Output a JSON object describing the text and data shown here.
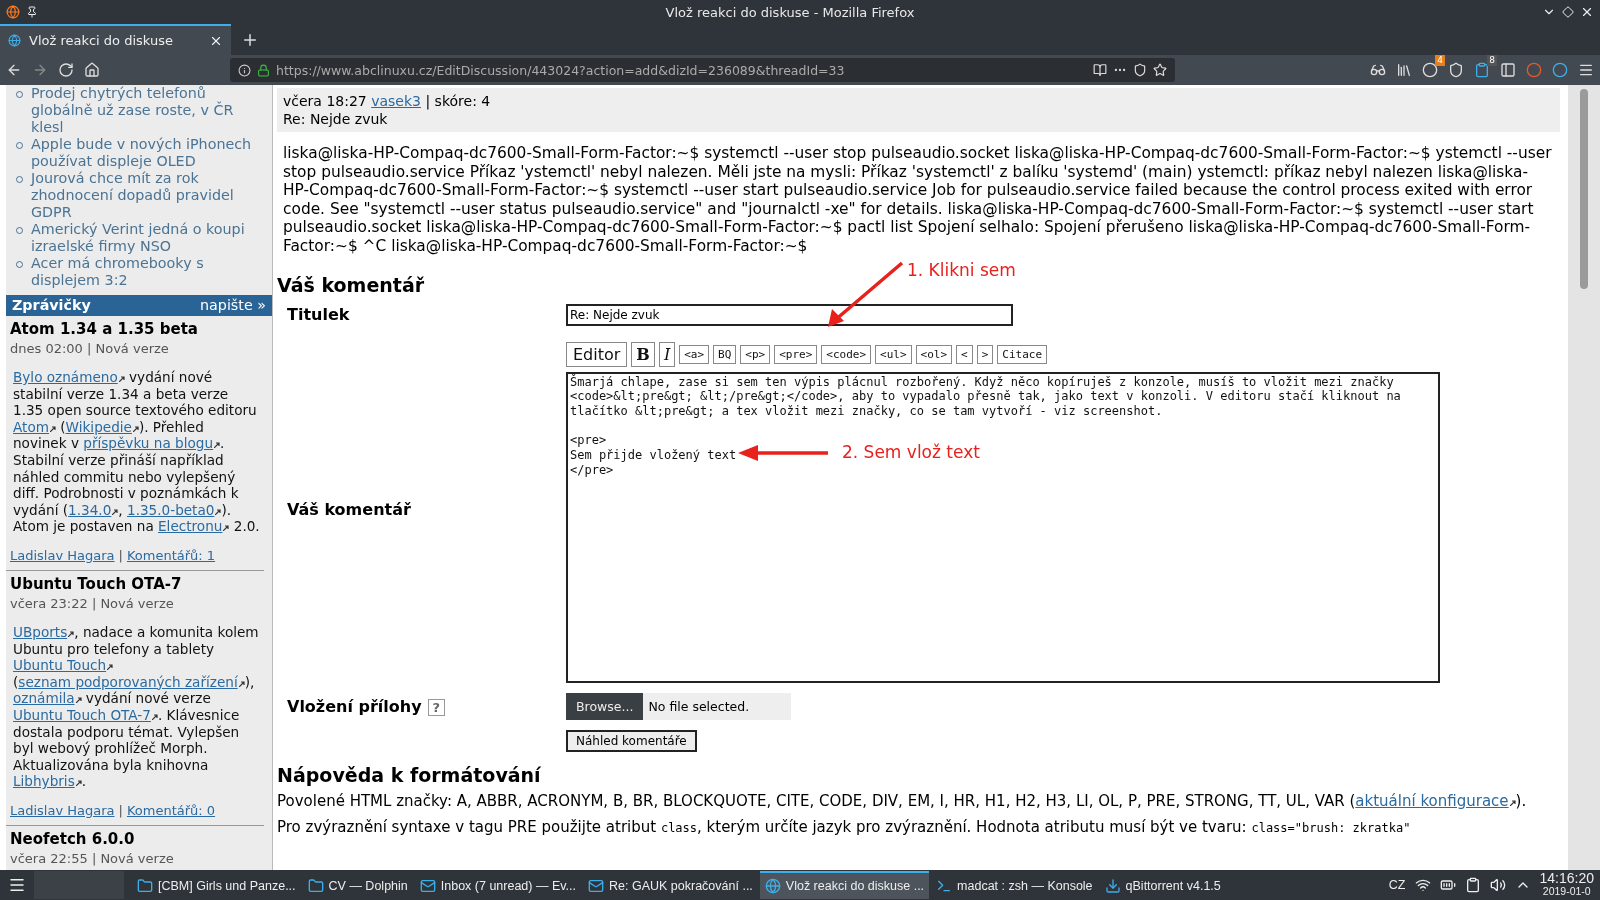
{
  "window": {
    "title": "Vlož reakci do diskuse - Mozilla Firefox"
  },
  "tabs": [
    {
      "label": "Vlož reakci do diskuse",
      "selected": true
    }
  ],
  "address_bar": {
    "url": "https://www.abclinuxu.cz/EditDiscussion/443024?action=add&dizId=236089&threadId=33"
  },
  "toolbar_badges": [
    "4",
    "8"
  ],
  "sidebar": {
    "news_links": [
      "Prodej chytrých telefonů globálně už zase roste, v ČR klesl",
      "Apple bude v nových iPhonech používat displeje OLED",
      "Jourová chce mít za rok zhodnocení dopadů pravidel GDPR",
      "Americký Verint jedná o koupi izraelské firmy NSO",
      "Acer má chromebooky s displejem 3:2"
    ],
    "section": {
      "title": "Zprávičky",
      "action": "napište »"
    },
    "news": [
      {
        "title": "Atom 1.34 a 1.35 beta",
        "meta": "dnes 02:00 | Nová verze",
        "body": [
          {
            "kind": "link",
            "text": "Bylo oznámeno"
          },
          {
            "kind": "text",
            "text": " vydání nové stabilní verze 1.34 a beta verze 1.35 open source textového editoru "
          },
          {
            "kind": "link",
            "text": "Atom"
          },
          {
            "kind": "text",
            "text": " ("
          },
          {
            "kind": "link",
            "text": "Wikipedie"
          },
          {
            "kind": "text",
            "text": "). Přehled novinek v "
          },
          {
            "kind": "link",
            "text": "příspěvku na blogu"
          },
          {
            "kind": "text",
            "text": ". Stabilní verze přináší například náhled commitu nebo vylepšený diff. Podrobnosti v poznámkách k vydání ("
          },
          {
            "kind": "link",
            "text": "1.34.0"
          },
          {
            "kind": "text",
            "text": ", "
          },
          {
            "kind": "link",
            "text": "1.35.0-beta0"
          },
          {
            "kind": "text",
            "text": "). Atom je postaven na "
          },
          {
            "kind": "link",
            "text": "Electronu"
          },
          {
            "kind": "text",
            "text": " 2.0."
          }
        ],
        "author": "Ladislav Hagara",
        "separator": "|",
        "comments": "Komentářů: 1"
      },
      {
        "title": "Ubuntu Touch OTA-7",
        "meta": "včera 23:22 | Nová verze",
        "body": [
          {
            "kind": "link",
            "text": "UBports"
          },
          {
            "kind": "text",
            "text": ", nadace a komunita kolem Ubuntu pro telefony a tablety "
          },
          {
            "kind": "link",
            "text": "Ubuntu Touch"
          },
          {
            "kind": "text",
            "text": " ("
          },
          {
            "kind": "link",
            "text": "seznam podporovaných zařízení"
          },
          {
            "kind": "text",
            "text": "), "
          },
          {
            "kind": "link",
            "text": "oznámila"
          },
          {
            "kind": "text",
            "text": " vydání nové verze "
          },
          {
            "kind": "link",
            "text": "Ubuntu Touch OTA-7"
          },
          {
            "kind": "text",
            "text": ". Klávesnice dostala podporu témat. Vylepšen byl webový prohlížeč Morph. Aktualizována byla knihovna "
          },
          {
            "kind": "link",
            "text": "Libhybris"
          },
          {
            "kind": "text",
            "text": "."
          }
        ],
        "author": "Ladislav Hagara",
        "separator": "|",
        "comments": "Komentářů: 0"
      },
      {
        "title": "Neofetch 6.0.0",
        "meta": "včera 22:55 | Nová verze"
      }
    ]
  },
  "comment": {
    "meta": [
      {
        "kind": "text",
        "text": "včera 18:27 "
      },
      {
        "kind": "link",
        "text": "vasek3"
      },
      {
        "kind": "text",
        "text": " | skóre: 4"
      }
    ],
    "subject": "Re: Nejde zvuk",
    "body": "liska@liska-HP-Compaq-dc7600-Small-Form-Factor:~$ systemctl --user stop pulseaudio.socket liska@liska-HP-Compaq-dc7600-Small-Form-Factor:~$ ystemctl --user stop pulseaudio.service Příkaz 'ystemctl' nebyl nalezen. Měli jste na mysli: Příkaz 'systemctl' z balíku 'systemd' (main) ystemctl: příkaz nebyl nalezen liska@liska-HP-Compaq-dc7600-Small-Form-Factor:~$ systemctl --user start pulseaudio.service Job for pulseaudio.service failed because the control process exited with error code. See \"systemctl --user status pulseaudio.service\" and \"journalctl -xe\" for details. liska@liska-HP-Compaq-dc7600-Small-Form-Factor:~$ systemctl --user start pulseaudio.socket liska@liska-HP-Compaq-dc7600-Small-Form-Factor:~$ pactl list Spojení selhalo: Spojení přerušeno liska@liska-HP-Compaq-dc7600-Small-Form-Factor:~$ ^C liska@liska-HP-Compaq-dc7600-Small-Form-Factor:~$"
  },
  "form": {
    "heading": "Váš komentář",
    "title_label": "Titulek",
    "title_value": "Re: Nejde zvuk",
    "editor_buttons": [
      {
        "label": "Editor",
        "kind": "mode"
      },
      {
        "label": "B",
        "kind": "bold"
      },
      {
        "label": "I",
        "kind": "italic"
      },
      {
        "label": "<a>",
        "kind": "tag"
      },
      {
        "label": "BQ",
        "kind": "tag"
      },
      {
        "label": "<p>",
        "kind": "tag"
      },
      {
        "label": "<pre>",
        "kind": "tag"
      },
      {
        "label": "<code>",
        "kind": "tag"
      },
      {
        "label": "<ul>",
        "kind": "tag"
      },
      {
        "label": "<ol>",
        "kind": "tag"
      },
      {
        "label": "<",
        "kind": "tag"
      },
      {
        "label": ">",
        "kind": "tag"
      },
      {
        "label": "Citace",
        "kind": "tag"
      }
    ],
    "comment_label": "Váš komentář",
    "comment_value": "Šmarjá chlape, zase si sem ten výpis plácnul rozbořený. Když něco kopíruješ z konzole, musíš to vložit mezi značky <code>&lt;pre&gt; &lt;/pre&gt;</code>, aby to vypadalo přesně tak, jako text v konzoli. V editoru stačí kliknout na tlačítko &lt;pre&gt; a tex vložit mezi značky, co se tam vytvoří - viz screenshot.\n\n<pre>\nSem přijde vložený text\n</pre>",
    "attachment_label": "Vložení přílohy",
    "help_mark": "?",
    "browse_button": "Browse...",
    "file_status": "No file selected.",
    "preview_button": "Náhled komentáře"
  },
  "annotations": [
    {
      "text": "1. Klikni sem"
    },
    {
      "text": "2. Sem vlož text"
    }
  ],
  "help": {
    "heading": "Nápověda k formátování",
    "paragraphs": [
      [
        {
          "kind": "text",
          "text": "Povolené HTML značky: A, ABBR, ACRONYM, B, BR, BLOCKQUOTE, CITE, CODE, DIV, EM, I, HR, H1, H2, H3, LI, OL, P, PRE, STRONG, TT, UL, VAR ("
        },
        {
          "kind": "link",
          "text": "aktuální konfigurace"
        },
        {
          "kind": "text",
          "text": ")."
        }
      ],
      [
        {
          "kind": "text",
          "text": "Pro zvýraznění syntaxe v tagu PRE použijte atribut "
        },
        {
          "kind": "code",
          "text": "class"
        },
        {
          "kind": "text",
          "text": ", kterým určíte jazyk pro zvýraznění. Hodnota atributu musí být ve tvaru: "
        },
        {
          "kind": "code",
          "text": "class=\"brush: zkratka\""
        }
      ]
    ]
  },
  "taskbar": {
    "windows": [
      {
        "label": "[CBM] Girls und Panze...",
        "kind": "folder",
        "selected": false
      },
      {
        "label": "CV — Dolphin",
        "kind": "folder",
        "selected": false
      },
      {
        "label": "Inbox (7 unread) — Ev...",
        "kind": "mail",
        "selected": false
      },
      {
        "label": "Re: GAUK pokračování ...",
        "kind": "mail",
        "selected": false
      },
      {
        "label": "Vlož reakci do diskuse ...",
        "kind": "browser",
        "selected": true
      },
      {
        "label": "madcat : zsh — Konsole",
        "kind": "terminal",
        "selected": false
      },
      {
        "label": "qBittorrent v4.1.5",
        "kind": "torrent",
        "selected": false
      }
    ],
    "layout": "CZ",
    "time": "14:16:20",
    "date": "2019-01-0"
  }
}
